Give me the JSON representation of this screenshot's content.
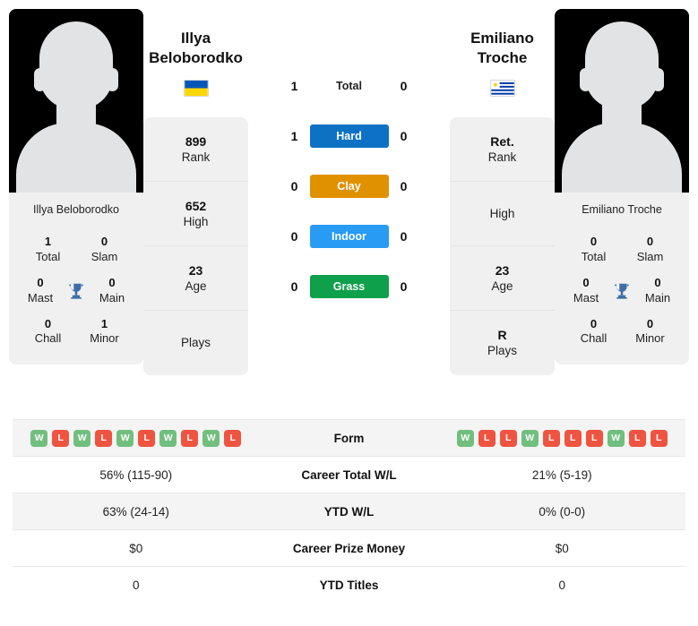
{
  "players": {
    "left": {
      "name": "Illya Beloborodko",
      "name_line1": "Illya",
      "name_line2": "Beloborodko",
      "photo_caption": "Illya Beloborodko",
      "country": "Ukraine",
      "flag_colors": [
        "#0057B7",
        "#FFD700"
      ],
      "info": [
        {
          "value": "899",
          "label": "Rank"
        },
        {
          "value": "652",
          "label": "High"
        },
        {
          "value": "23",
          "label": "Age"
        },
        {
          "value": "",
          "label": "Plays"
        }
      ],
      "titles": [
        {
          "value": "1",
          "label": "Total"
        },
        {
          "value": "0",
          "label": "Slam"
        },
        {
          "value": "0",
          "label": "Mast"
        },
        {
          "value": "0",
          "label": "Main"
        },
        {
          "value": "0",
          "label": "Chall"
        },
        {
          "value": "1",
          "label": "Minor"
        }
      ],
      "form": [
        "W",
        "L",
        "W",
        "L",
        "W",
        "L",
        "W",
        "L",
        "W",
        "L"
      ],
      "career_total_wl": "56% (115-90)",
      "ytd_wl": "63% (24-14)",
      "career_prize_money": "$0",
      "ytd_titles": "0"
    },
    "right": {
      "name": "Emiliano Troche",
      "name_line1": "Emiliano",
      "name_line2": "Troche",
      "photo_caption": "Emiliano Troche",
      "country": "Uruguay",
      "flag_colors": [
        "#ffffff",
        "#0038A8",
        "#FCD116"
      ],
      "info": [
        {
          "value": "Ret.",
          "label": "Rank"
        },
        {
          "value": "",
          "label": "High"
        },
        {
          "value": "23",
          "label": "Age"
        },
        {
          "value": "R",
          "label": "Plays"
        }
      ],
      "titles": [
        {
          "value": "0",
          "label": "Total"
        },
        {
          "value": "0",
          "label": "Slam"
        },
        {
          "value": "0",
          "label": "Mast"
        },
        {
          "value": "0",
          "label": "Main"
        },
        {
          "value": "0",
          "label": "Chall"
        },
        {
          "value": "0",
          "label": "Minor"
        }
      ],
      "form": [
        "W",
        "L",
        "L",
        "W",
        "L",
        "L",
        "L",
        "W",
        "L",
        "L"
      ],
      "career_total_wl": "21% (5-19)",
      "ytd_wl": "0% (0-0)",
      "career_prize_money": "$0",
      "ytd_titles": "0"
    }
  },
  "head_to_head": {
    "total": {
      "label": "Total",
      "left": "1",
      "right": "0"
    },
    "surfaces": [
      {
        "label": "Hard",
        "color": "#0d72c4",
        "left": "1",
        "right": "0"
      },
      {
        "label": "Clay",
        "color": "#e09100",
        "left": "0",
        "right": "0"
      },
      {
        "label": "Indoor",
        "color": "#289bf5",
        "left": "0",
        "right": "0"
      },
      {
        "label": "Grass",
        "color": "#0ea04a",
        "left": "0",
        "right": "0"
      }
    ]
  },
  "stat_table": {
    "rows": [
      {
        "label": "Form",
        "type": "form"
      },
      {
        "label": "Career Total W/L",
        "type": "text",
        "left": "56% (115-90)",
        "right": "21% (5-19)"
      },
      {
        "label": "YTD W/L",
        "type": "text",
        "left": "63% (24-14)",
        "right": "0% (0-0)"
      },
      {
        "label": "Career Prize Money",
        "type": "text",
        "left": "$0",
        "right": "$0"
      },
      {
        "label": "YTD Titles",
        "type": "text",
        "left": "0",
        "right": "0"
      }
    ]
  },
  "icons": {
    "trophy": "trophy-icon"
  },
  "colors": {
    "win": "#71bf7e",
    "loss": "#ef5441",
    "card_bg": "#f0f0f0",
    "row_alt_bg": "#f4f4f4"
  }
}
